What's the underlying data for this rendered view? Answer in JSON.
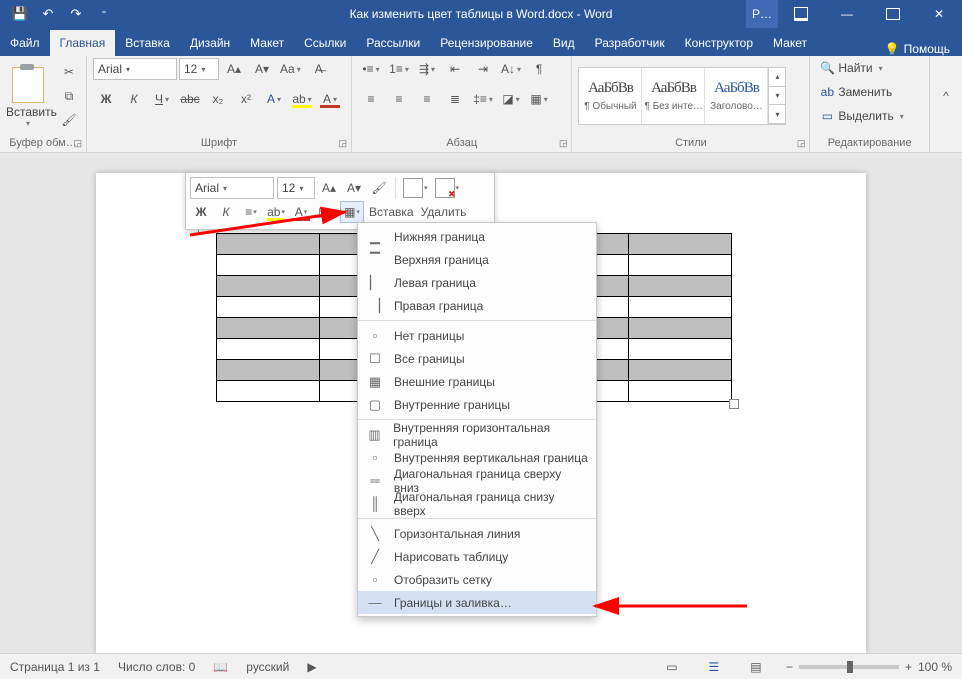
{
  "title": "Как изменить цвет таблицы в Word.docx  -  Word",
  "qat": {
    "save": "💾",
    "undo": "↶",
    "redo": "↷",
    "more": "▾"
  },
  "contextTabLetter": "Р…",
  "tabs": {
    "file": "Файл",
    "home": "Главная",
    "insert": "Вставка",
    "design": "Дизайн",
    "layout": "Макет",
    "references": "Ссылки",
    "mailings": "Рассылки",
    "review": "Рецензирование",
    "view": "Вид",
    "developer": "Разработчик",
    "construct": "Конструктор",
    "tlayout": "Макет",
    "help": "Помощь"
  },
  "ribbon": {
    "clipboard": "Буфер обм…",
    "paste": "Вставить",
    "fontGroup": "Шрифт",
    "fontName": "Arial",
    "fontSize": "12",
    "paragraphGroup": "Абзац",
    "stylesGroup": "Стили",
    "styles": [
      {
        "sample": "АаБбВв",
        "label": "¶ Обычный"
      },
      {
        "sample": "АаБбВв",
        "label": "¶ Без инте…"
      },
      {
        "sample": "АаБбВв",
        "label": "Заголово…"
      }
    ],
    "editGroup": "Редактирование",
    "find": "Найти",
    "replace": "Заменить",
    "select": "Выделить"
  },
  "minitool": {
    "font": "Arial",
    "size": "12",
    "insert": "Вставка",
    "delete": "Удалить"
  },
  "bordersMenu": [
    "Нижняя граница",
    "Верхняя граница",
    "Левая граница",
    "Правая граница",
    "---",
    "Нет границы",
    "Все границы",
    "Внешние границы",
    "Внутренние границы",
    "---",
    "Внутренняя горизонтальная граница",
    "Внутренняя вертикальная граница",
    "Диагональная граница сверху вниз",
    "Диагональная граница снизу вверх",
    "---",
    "Горизонтальная линия",
    "Нарисовать таблицу",
    "Отобразить сетку",
    "Границы и заливка…"
  ],
  "status": {
    "page": "Страница 1 из 1",
    "words": "Число слов: 0",
    "lang": "русский",
    "zoom": "100 %"
  }
}
